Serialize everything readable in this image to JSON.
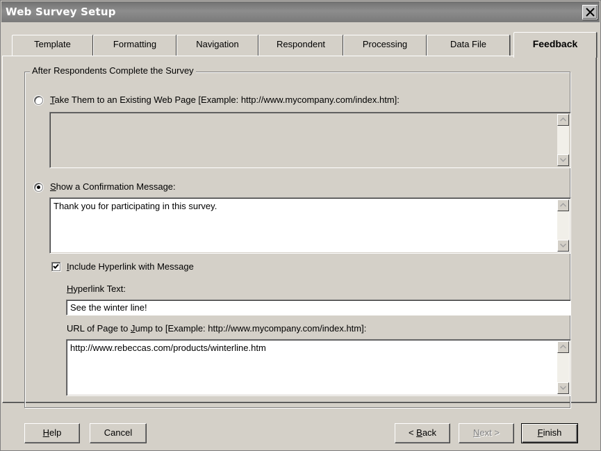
{
  "window": {
    "title": "Web Survey Setup"
  },
  "tabs": [
    {
      "label": "Template"
    },
    {
      "label": "Formatting"
    },
    {
      "label": "Navigation"
    },
    {
      "label": "Respondent"
    },
    {
      "label": "Processing"
    },
    {
      "label": "Data File"
    },
    {
      "label": "Feedback",
      "active": true
    }
  ],
  "group": {
    "label": "After Respondents Complete the Survey",
    "existing_page": {
      "mnemonic": "T",
      "label_rest": "ake Them to an Existing Web Page [Example: http://www.mycompany.com/index.htm]:",
      "selected": false,
      "value": ""
    },
    "confirmation": {
      "mnemonic": "S",
      "label_rest": "how a Confirmation Message:",
      "selected": true,
      "message": "Thank you for participating in this survey."
    },
    "hyperlink": {
      "mnemonic": "I",
      "label_rest": "nclude Hyperlink with Message",
      "checked": true,
      "text_label_mnemonic": "H",
      "text_label_rest": "yperlink Text:",
      "text_value": "See the winter line!",
      "url_label_pre": "URL of Page to ",
      "url_label_mnemonic": "J",
      "url_label_post": "ump to [Example: http://www.mycompany.com/index.htm]:",
      "url_value": "http://www.rebeccas.com/products/winterline.htm"
    }
  },
  "buttons": {
    "help_mnemonic": "H",
    "help_rest": "elp",
    "cancel": "Cancel",
    "back_pre": "< ",
    "back_mnemonic": "B",
    "back_rest": "ack",
    "next_mnemonic": "N",
    "next_rest": "ext >",
    "finish_mnemonic": "F",
    "finish_rest": "inish"
  }
}
